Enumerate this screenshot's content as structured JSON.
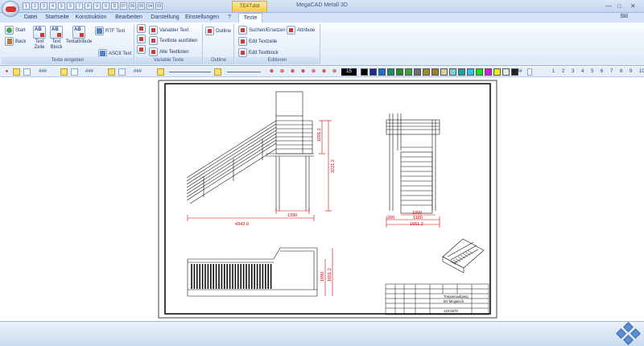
{
  "titlebar": {
    "title": "MegaCAD Metall 3D",
    "context_tab": "TEXT.dot",
    "qa_labels": [
      "1",
      "2",
      "3",
      "4",
      "5",
      "6",
      "7",
      "8",
      "9",
      "0",
      "D",
      "07",
      "06",
      "05",
      "04",
      "03"
    ],
    "window_buttons": [
      "—",
      "□",
      "✕"
    ]
  },
  "tabs": [
    {
      "label": "Datei"
    },
    {
      "label": "Startseite"
    },
    {
      "label": "Konstruktion"
    },
    {
      "label": "Bearbeiten"
    },
    {
      "label": "Darstellung"
    },
    {
      "label": "Einstellungen"
    },
    {
      "label": "?"
    },
    {
      "label": "Texte"
    }
  ],
  "ribbon_style_label": "Stil",
  "ribbon": {
    "groups": [
      {
        "label": "Texte eingeben"
      },
      {
        "label": "Variable Texte"
      },
      {
        "label": "Outline"
      },
      {
        "label": "Editieren"
      }
    ],
    "buttons": {
      "start": "Start",
      "back": "Back",
      "text_zeile": "Text\nZeile",
      "text_block": "Text\nBlock",
      "textattribute": "Textattribute",
      "rtf_text": "RTF Text",
      "ascii_text": "ASCII Text",
      "variabler_text": "Variabler Text",
      "textliste_ausfuellen": "Textliste ausfüllen",
      "alle_textlisten": "Alle Textlisten",
      "outline": "Outline",
      "suchen_ersetzen": "Suchen/Ersetzen",
      "edit_textzeile": "Edit Textzeile",
      "edit_textblock": "Edit Textblock",
      "attribute": "Attribute"
    },
    "small_icon_labels": [
      "TEXT",
      "TEXT",
      "EDIT",
      "EDIT"
    ]
  },
  "toolbar": {
    "hash_labels": [
      "###",
      "###",
      "###"
    ],
    "number_box": "15",
    "swatch_colors": [
      "#000000",
      "#1d2a8a",
      "#1673c8",
      "#1a8a6a",
      "#2a8a2a",
      "#3aa53a",
      "#707070",
      "#9e8a2a",
      "#a07a30",
      "#d7cfa0",
      "#7dd0d0",
      "#1fa0a0",
      "#2ec1ec",
      "#18e018",
      "#d41cd4",
      "#ecec20",
      "#e8e8e8",
      "#202020"
    ],
    "grid_label": "##",
    "layer_numbers": [
      "1",
      "2",
      "3",
      "4",
      "5",
      "6",
      "7",
      "8",
      "9",
      "10"
    ]
  },
  "drawing": {
    "dimensions": {
      "side_height_upper": "1091.2",
      "side_height_total": "3221.2",
      "side_platform": "1390",
      "side_total_length": "4343.9",
      "front_width_a": "1000",
      "front_width_b": "1180",
      "front_width_total": "1651.2",
      "front_small": "200",
      "plan_height_a": "1090",
      "plan_height_b": "1651.2"
    },
    "title_block": {
      "title": "Treppenaufgang",
      "subtitle": "BV Megatech",
      "number": "123-5678"
    }
  },
  "colors": {
    "ribbon_bg": "#dde9f8",
    "accent_context_tab": "#f5c84c",
    "drawing_line": "#111111",
    "dimension_red": "#d40000"
  }
}
